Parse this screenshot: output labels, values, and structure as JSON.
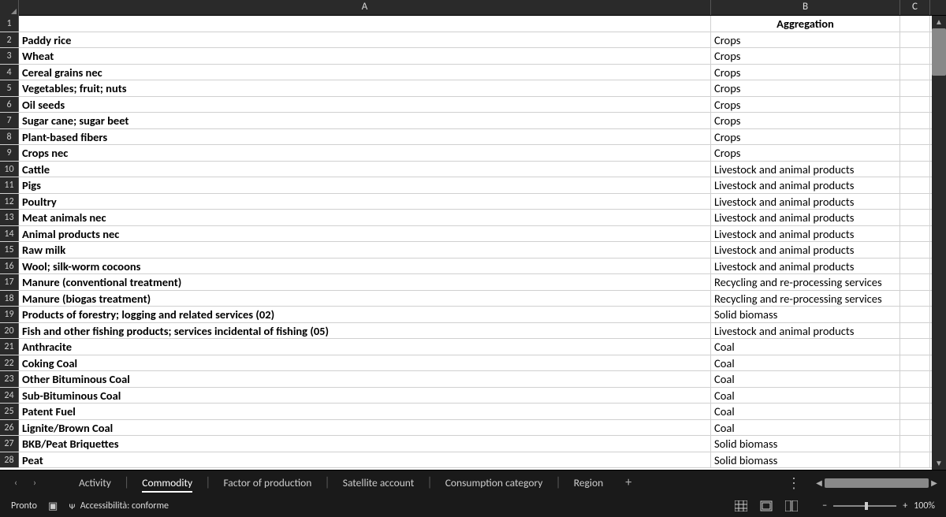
{
  "columns": [
    "A",
    "B",
    "C"
  ],
  "header_row": {
    "a": "",
    "b": "Aggregation"
  },
  "rows": [
    {
      "n": 2,
      "a": "Paddy rice",
      "b": "Crops"
    },
    {
      "n": 3,
      "a": "Wheat",
      "b": "Crops"
    },
    {
      "n": 4,
      "a": "Cereal grains nec",
      "b": "Crops"
    },
    {
      "n": 5,
      "a": "Vegetables; fruit; nuts",
      "b": "Crops"
    },
    {
      "n": 6,
      "a": "Oil seeds",
      "b": "Crops"
    },
    {
      "n": 7,
      "a": "Sugar cane; sugar beet",
      "b": "Crops"
    },
    {
      "n": 8,
      "a": "Plant-based fibers",
      "b": "Crops"
    },
    {
      "n": 9,
      "a": "Crops nec",
      "b": "Crops"
    },
    {
      "n": 10,
      "a": "Cattle",
      "b": "Livestock and animal products"
    },
    {
      "n": 11,
      "a": "Pigs",
      "b": "Livestock and animal products"
    },
    {
      "n": 12,
      "a": "Poultry",
      "b": "Livestock and animal products"
    },
    {
      "n": 13,
      "a": "Meat animals nec",
      "b": "Livestock and animal products"
    },
    {
      "n": 14,
      "a": "Animal products nec",
      "b": "Livestock and animal products"
    },
    {
      "n": 15,
      "a": "Raw milk",
      "b": "Livestock and animal products"
    },
    {
      "n": 16,
      "a": "Wool; silk-worm cocoons",
      "b": "Livestock and animal products"
    },
    {
      "n": 17,
      "a": "Manure (conventional treatment)",
      "b": "Recycling and re-processing services"
    },
    {
      "n": 18,
      "a": "Manure (biogas treatment)",
      "b": "Recycling and re-processing services"
    },
    {
      "n": 19,
      "a": "Products of forestry; logging and related services (02)",
      "b": "Solid biomass"
    },
    {
      "n": 20,
      "a": "Fish and other fishing products; services incidental of fishing (05)",
      "b": "Livestock and animal products"
    },
    {
      "n": 21,
      "a": "Anthracite",
      "b": "Coal"
    },
    {
      "n": 22,
      "a": "Coking Coal",
      "b": "Coal"
    },
    {
      "n": 23,
      "a": "Other Bituminous Coal",
      "b": "Coal"
    },
    {
      "n": 24,
      "a": "Sub-Bituminous Coal",
      "b": "Coal"
    },
    {
      "n": 25,
      "a": "Patent Fuel",
      "b": "Coal"
    },
    {
      "n": 26,
      "a": "Lignite/Brown Coal",
      "b": "Coal"
    },
    {
      "n": 27,
      "a": "BKB/Peat Briquettes",
      "b": "Solid biomass"
    },
    {
      "n": 28,
      "a": "Peat",
      "b": "Solid biomass"
    }
  ],
  "tabs": [
    {
      "label": "Activity",
      "active": false
    },
    {
      "label": "Commodity",
      "active": true
    },
    {
      "label": "Factor of production",
      "active": false
    },
    {
      "label": "Satellite account",
      "active": false
    },
    {
      "label": "Consumption category",
      "active": false
    },
    {
      "label": "Region",
      "active": false
    }
  ],
  "status": {
    "ready": "Pronto",
    "accessibility": "Accessibilità: conforme"
  },
  "zoom": {
    "minus": "−",
    "plus": "+",
    "value": "100%"
  }
}
